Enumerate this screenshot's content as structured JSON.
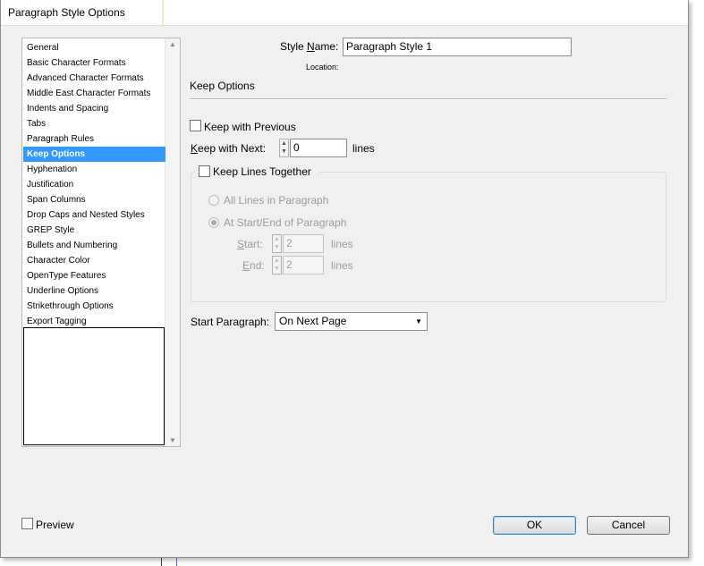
{
  "window": {
    "title": "Paragraph Style Options"
  },
  "sidebar": {
    "items": [
      {
        "label": "General"
      },
      {
        "label": "Basic Character Formats"
      },
      {
        "label": "Advanced Character Formats"
      },
      {
        "label": "Middle East Character Formats"
      },
      {
        "label": "Indents and Spacing"
      },
      {
        "label": "Tabs"
      },
      {
        "label": "Paragraph Rules"
      },
      {
        "label": "Keep Options",
        "selected": true
      },
      {
        "label": "Hyphenation"
      },
      {
        "label": "Justification"
      },
      {
        "label": "Span Columns"
      },
      {
        "label": "Drop Caps and Nested Styles"
      },
      {
        "label": "GREP Style"
      },
      {
        "label": "Bullets and Numbering"
      },
      {
        "label": "Character Color"
      },
      {
        "label": "OpenType Features"
      },
      {
        "label": "Underline Options"
      },
      {
        "label": "Strikethrough Options"
      },
      {
        "label": "Export Tagging"
      }
    ]
  },
  "style_name": {
    "label_pre": "Style ",
    "label_ul": "N",
    "label_post": "ame:",
    "value": "Paragraph Style 1"
  },
  "location": {
    "label": "Location:"
  },
  "section": {
    "title": "Keep Options"
  },
  "keep_with_previous": {
    "label": "Keep with Previous",
    "checked": false
  },
  "keep_with_next": {
    "label_ul": "K",
    "label_post": "eep with Next:",
    "value": "0",
    "unit": "lines"
  },
  "keep_lines_together": {
    "label": "Keep Lines Together",
    "checked": false
  },
  "radios": {
    "all_lines": {
      "label": "All Lines in Paragraph",
      "checked": false
    },
    "start_end": {
      "label": "At Start/End of Paragraph",
      "checked": true
    }
  },
  "start": {
    "label_ul": "S",
    "label_post": "tart:",
    "value": "2",
    "unit": "lines"
  },
  "end": {
    "label_ul": "E",
    "label_post": "nd:",
    "value": "2",
    "unit": "lines"
  },
  "start_paragraph": {
    "label": "Start Paragraph:",
    "value": "On Next Page"
  },
  "preview": {
    "label": "Preview",
    "checked": false
  },
  "buttons": {
    "ok": "OK",
    "cancel": "Cancel"
  }
}
